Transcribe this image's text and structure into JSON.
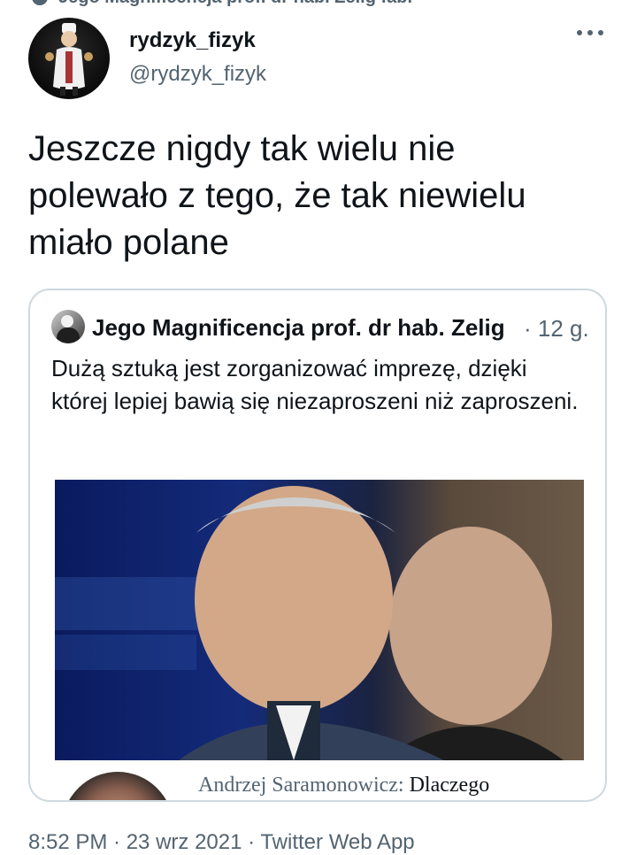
{
  "top_partial": {
    "text": "Jego Magnificencja prof. dr hab. Zelig fabr"
  },
  "tweet": {
    "author_name": "rydzyk_fizyk",
    "author_handle": "@rydzyk_fizyk",
    "text": "Jeszcze nigdy tak wielu nie polewało z tego, że tak niewielu miało polane"
  },
  "quote": {
    "author_name": "Jego Magnificencja prof. dr hab. Zelig",
    "time": "· 12 g.",
    "text": "Dużą sztuką jest zorganizować imprezę, dzięki której lepiej bawią się niezaproszeni niż zaproszeni.",
    "link_author": "Andrzej Saramonowicz:",
    "link_title": "Dlaczego"
  },
  "meta": {
    "text": "8:52 PM · 23 wrz 2021 · Twitter Web App"
  },
  "colors": {
    "text": "#0f1419",
    "secondary": "#536471",
    "border": "#cfd9de"
  }
}
